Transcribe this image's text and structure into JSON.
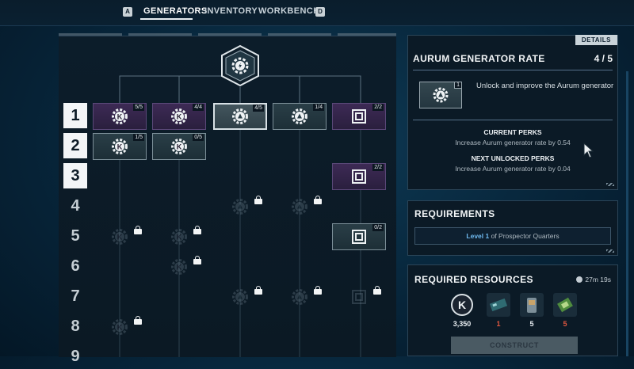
{
  "nav": {
    "left_key": "A",
    "right_key": "D",
    "tabs": [
      {
        "label": "GENERATORS",
        "active": true
      },
      {
        "label": "INVENTORY",
        "active": false
      },
      {
        "label": "WORKBENCH",
        "active": false
      }
    ]
  },
  "tree": {
    "rows": [
      "1",
      "2",
      "3",
      "4",
      "5",
      "6",
      "7",
      "8",
      "9"
    ],
    "unlocked_rows": 3,
    "nodes": [
      {
        "row": 1,
        "col": 1,
        "icon": "k-coin-gear-icon",
        "style": "purple",
        "count": "5/5"
      },
      {
        "row": 1,
        "col": 2,
        "icon": "k-coin-gear-icon",
        "style": "purple",
        "count": "4/4"
      },
      {
        "row": 1,
        "col": 3,
        "icon": "aurum-gear-icon",
        "style": "selected",
        "count": "4/5"
      },
      {
        "row": 1,
        "col": 4,
        "icon": "aurum-gear-icon",
        "style": "teal",
        "count": "1/4"
      },
      {
        "row": 1,
        "col": 5,
        "icon": "square-target-icon",
        "style": "purple",
        "count": "2/2"
      },
      {
        "row": 2,
        "col": 1,
        "icon": "k-coin-gear-icon",
        "style": "teal",
        "count": "1/5"
      },
      {
        "row": 2,
        "col": 2,
        "icon": "k-coin-gear-icon",
        "style": "teal",
        "count": "0/5"
      },
      {
        "row": 3,
        "col": 5,
        "icon": "square-target-icon",
        "style": "purple",
        "count": "2/2"
      },
      {
        "row": 5,
        "col": 5,
        "icon": "square-target-icon",
        "style": "teal",
        "count": "0/2"
      }
    ]
  },
  "details": {
    "tab_label": "DETAILS",
    "title": "AURUM GENERATOR RATE",
    "level": "4 / 5",
    "perk_count": "1",
    "perk_description": "Unlock and improve the Aurum generator",
    "current_perks_header": "CURRENT PERKS",
    "current_perks_text": "Increase Aurum generator rate by 0.54",
    "next_perks_header": "NEXT UNLOCKED PERKS",
    "next_perks_text": "Increase Aurum generator rate by 0.04"
  },
  "requirements": {
    "title": "REQUIREMENTS",
    "level_text": "Level 1",
    "building_text": " of Prospector Quarters"
  },
  "resources": {
    "title": "REQUIRED RESOURCES",
    "timer": "27m 19s",
    "items": [
      {
        "icon": "k-coin-icon",
        "value": "3,350",
        "color": "#e9eef2"
      },
      {
        "icon": "circuit-board-icon",
        "value": "1",
        "color": "#e0573f"
      },
      {
        "icon": "metal-canister-icon",
        "value": "5",
        "color": "#e9eef2"
      },
      {
        "icon": "green-chip-icon",
        "value": "5",
        "color": "#e0573f"
      }
    ],
    "construct_label": "CONSTRUCT"
  }
}
